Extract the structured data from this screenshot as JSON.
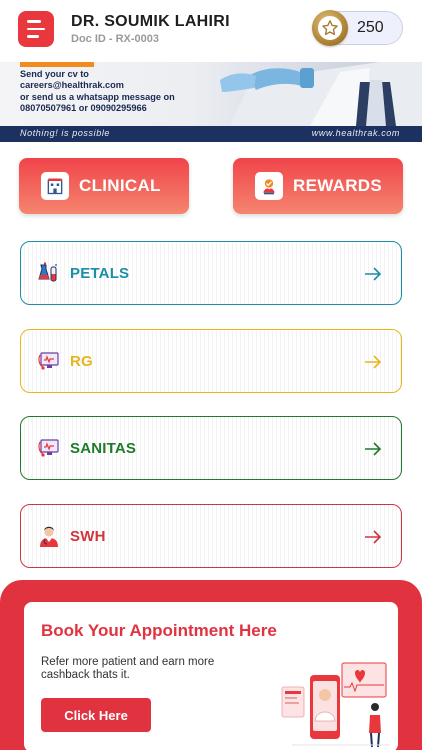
{
  "header": {
    "doctor_name": "DR. SOUMIK LAHIRI",
    "doc_id": "Doc ID - RX-0003",
    "points": "250",
    "accent_color": "#e8383e"
  },
  "banner": {
    "lines": [
      "Send your cv to",
      "careers@healthrak.com",
      "or send us a whatsapp message on",
      "08070507961 or 09090295966"
    ],
    "tagline": "Nothing! is possible",
    "website": "www.healthrak.com"
  },
  "tabs": [
    {
      "label": "CLINICAL",
      "icon": "clinic-building-icon"
    },
    {
      "label": "REWARDS",
      "icon": "reward-gift-icon"
    }
  ],
  "categories": [
    {
      "label": "PETALS",
      "color": "#1b8ea6",
      "icon": "lab-flasks-icon"
    },
    {
      "label": "RG",
      "color": "#e8b61c",
      "icon": "monitor-stethoscope-icon"
    },
    {
      "label": "SANITAS",
      "color": "#1e7a2c",
      "icon": "monitor-stethoscope-icon"
    },
    {
      "label": "SWH",
      "color": "#d3343c",
      "icon": "doctor-icon"
    }
  ],
  "appointment": {
    "title": "Book Your Appointment Here",
    "description": "Refer more patient and earn more cashback thats it.",
    "button_label": "Click Here"
  }
}
